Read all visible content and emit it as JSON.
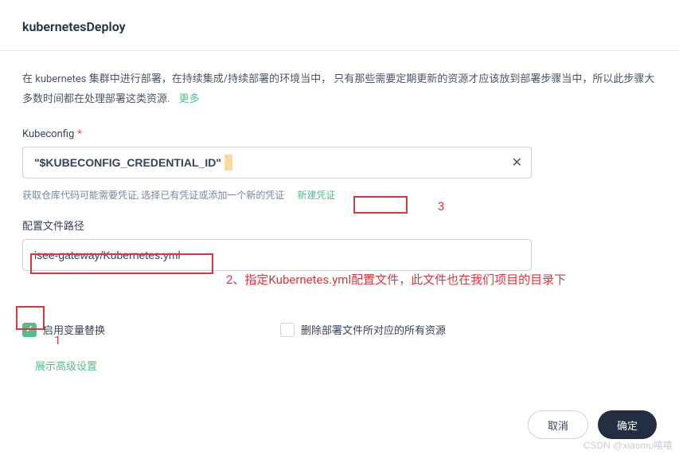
{
  "header": {
    "title": "kubernetesDeploy"
  },
  "description": {
    "text": "在 kubernetes 集群中进行部署，在持续集成/持续部署的环境当中，  只有那些需要定期更新的资源才应该放到部署步骤当中，所以此步骤大多数时间都在处理部署这类资源.",
    "more": "更多"
  },
  "kubeconfig": {
    "label": "Kubeconfig",
    "value": "\"$KUBECONFIG_CREDENTIAL_ID\"",
    "hint": "获取仓库代码可能需要凭证, 选择已有凭证或添加一个新的凭证",
    "new_credential": "新建凭证"
  },
  "config_path": {
    "label": "配置文件路径",
    "value": "isee-gateway/Kubernetes.yml"
  },
  "checkboxes": {
    "enable_var_replace": "启用变量替换",
    "delete_resources": "删除部署文件所对应的所有资源"
  },
  "advanced": {
    "label": "展示高级设置"
  },
  "footer": {
    "cancel": "取消",
    "ok": "确定"
  },
  "annotations": {
    "n1": "1",
    "n2": "2、指定Kubernetes.yml配置文件，此文件也在我们项目的目录下",
    "n3": "3"
  },
  "watermark": "CSDN @xiaomu嘻嘻"
}
